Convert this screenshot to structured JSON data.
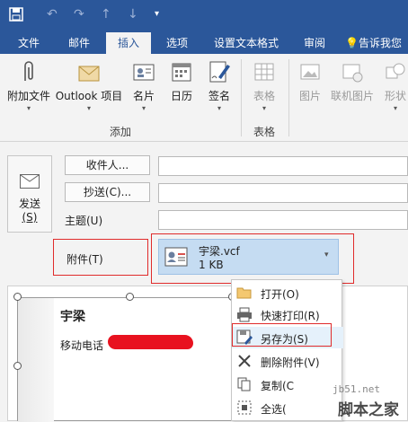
{
  "ribbon_tabs": [
    "文件",
    "邮件",
    "插入",
    "选项",
    "设置文本格式",
    "审阅",
    "告诉我您"
  ],
  "active_tab": "插入",
  "ribbon": {
    "attach_file": "附加文件",
    "outlook_item": "Outlook 项目",
    "business_card": "名片",
    "calendar": "日历",
    "signature": "签名",
    "group_add": "添加",
    "table": "表格",
    "group_table": "表格",
    "picture": "图片",
    "online_picture": "联机图片",
    "shapes": "形状"
  },
  "compose": {
    "send": "发送",
    "send_key": "(S)",
    "to_button": "收件人...",
    "cc_button": "抄送(C)...",
    "subject_label": "主题(U)",
    "attachment_label": "附件(T)"
  },
  "attachment": {
    "name": "宇梁.vcf",
    "size": "1 KB"
  },
  "card": {
    "name": "宇梁",
    "phone_label": "移动电话"
  },
  "context_menu": [
    {
      "label": "打开(O)",
      "icon": "open-folder-icon"
    },
    {
      "label": "快速打印(R)",
      "icon": "printer-icon"
    },
    {
      "label": "另存为(S)",
      "icon": "save-as-icon"
    },
    {
      "label": "删除附件(V)",
      "icon": "delete-x-icon"
    },
    {
      "label": "复制(C",
      "icon": "copy-icon"
    },
    {
      "label": "全选(",
      "icon": "select-all-icon"
    }
  ],
  "watermark": {
    "site": "jb51.net",
    "name": "脚本之家"
  },
  "colors": {
    "ribbon_blue": "#2b579a",
    "highlight_red": "#e02b2b",
    "attachment_bg": "#c5dcf2"
  }
}
